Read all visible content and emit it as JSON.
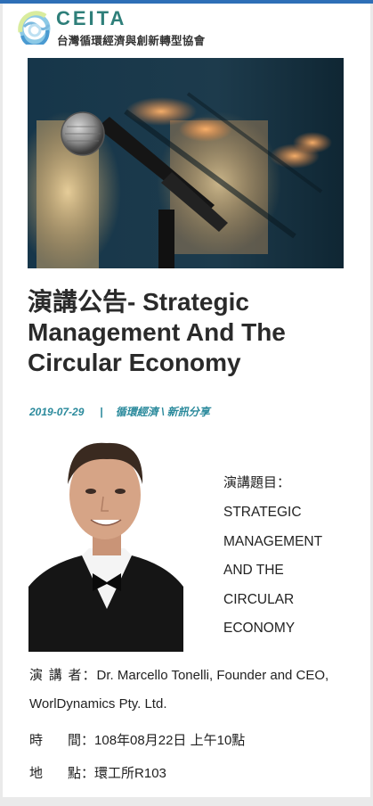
{
  "header": {
    "brand": "CEITA",
    "subtitle": "台灣循環經濟與創新轉型協會"
  },
  "article": {
    "title": "演講公告- Strategic Management And The Circular Economy",
    "date": "2019-07-29",
    "separator": "|",
    "categories": "循環經濟 \\ 新訊分享",
    "topic_label": "演講題目：",
    "topic_lines": [
      "STRATEGIC",
      "MANAGEMENT",
      "AND THE",
      "CIRCULAR",
      "ECONOMY"
    ],
    "speaker_label": "演 講 者：",
    "speaker_value": "Dr. Marcello Tonelli, Founder and CEO, WorlDynamics Pty. Ltd.",
    "time_label_1": "時",
    "time_label_2": "間：",
    "time_value": "108年08月22日 上午10點",
    "place_label_1": "地",
    "place_label_2": "點：",
    "place_value": "環工所R103"
  },
  "colors": {
    "brand": "#2f7f7a",
    "meta": "#2b8a9c",
    "top_strip": "#2e6fb7"
  },
  "icons": {
    "logo": "ceita-logo-icon"
  }
}
